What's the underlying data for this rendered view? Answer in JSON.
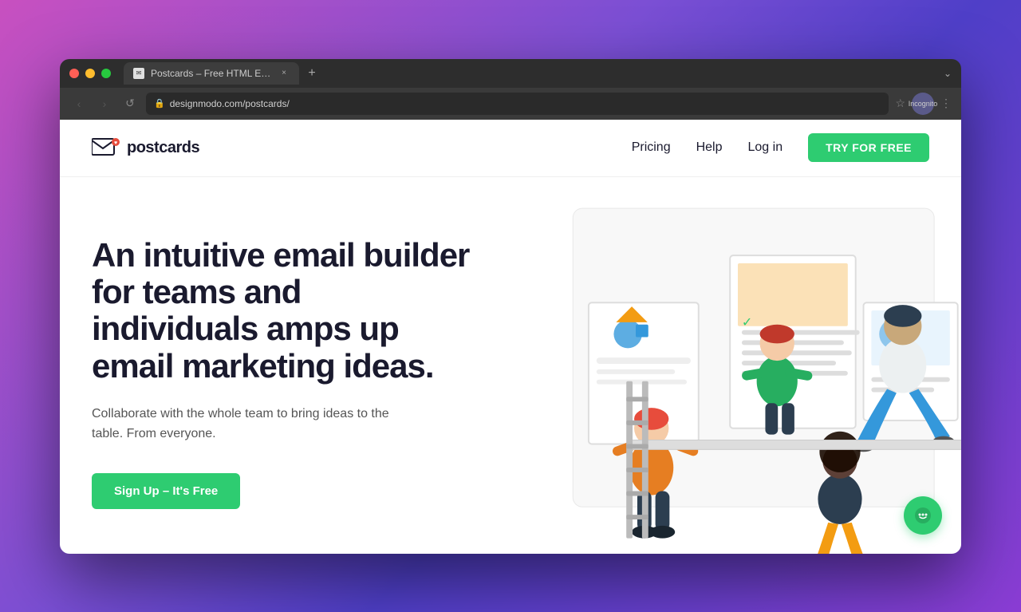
{
  "browser": {
    "tab_title": "Postcards – Free HTML Email",
    "url": "designmodo.com/postcards/",
    "incognito_label": "Incognito",
    "tab_close": "×",
    "tab_add": "+",
    "nav": {
      "back": "‹",
      "forward": "›",
      "refresh": "↺"
    }
  },
  "website": {
    "logo_text": "postcards",
    "nav": {
      "pricing": "Pricing",
      "help": "Help",
      "login": "Log in",
      "cta": "TRY FOR FREE"
    },
    "hero": {
      "title": "An intuitive email builder for teams and individuals amps up email marketing ideas.",
      "subtitle": "Collaborate with the whole team to bring ideas to the table. From everyone.",
      "cta": "Sign Up – It's Free"
    }
  },
  "chat": {
    "icon": "💬"
  }
}
